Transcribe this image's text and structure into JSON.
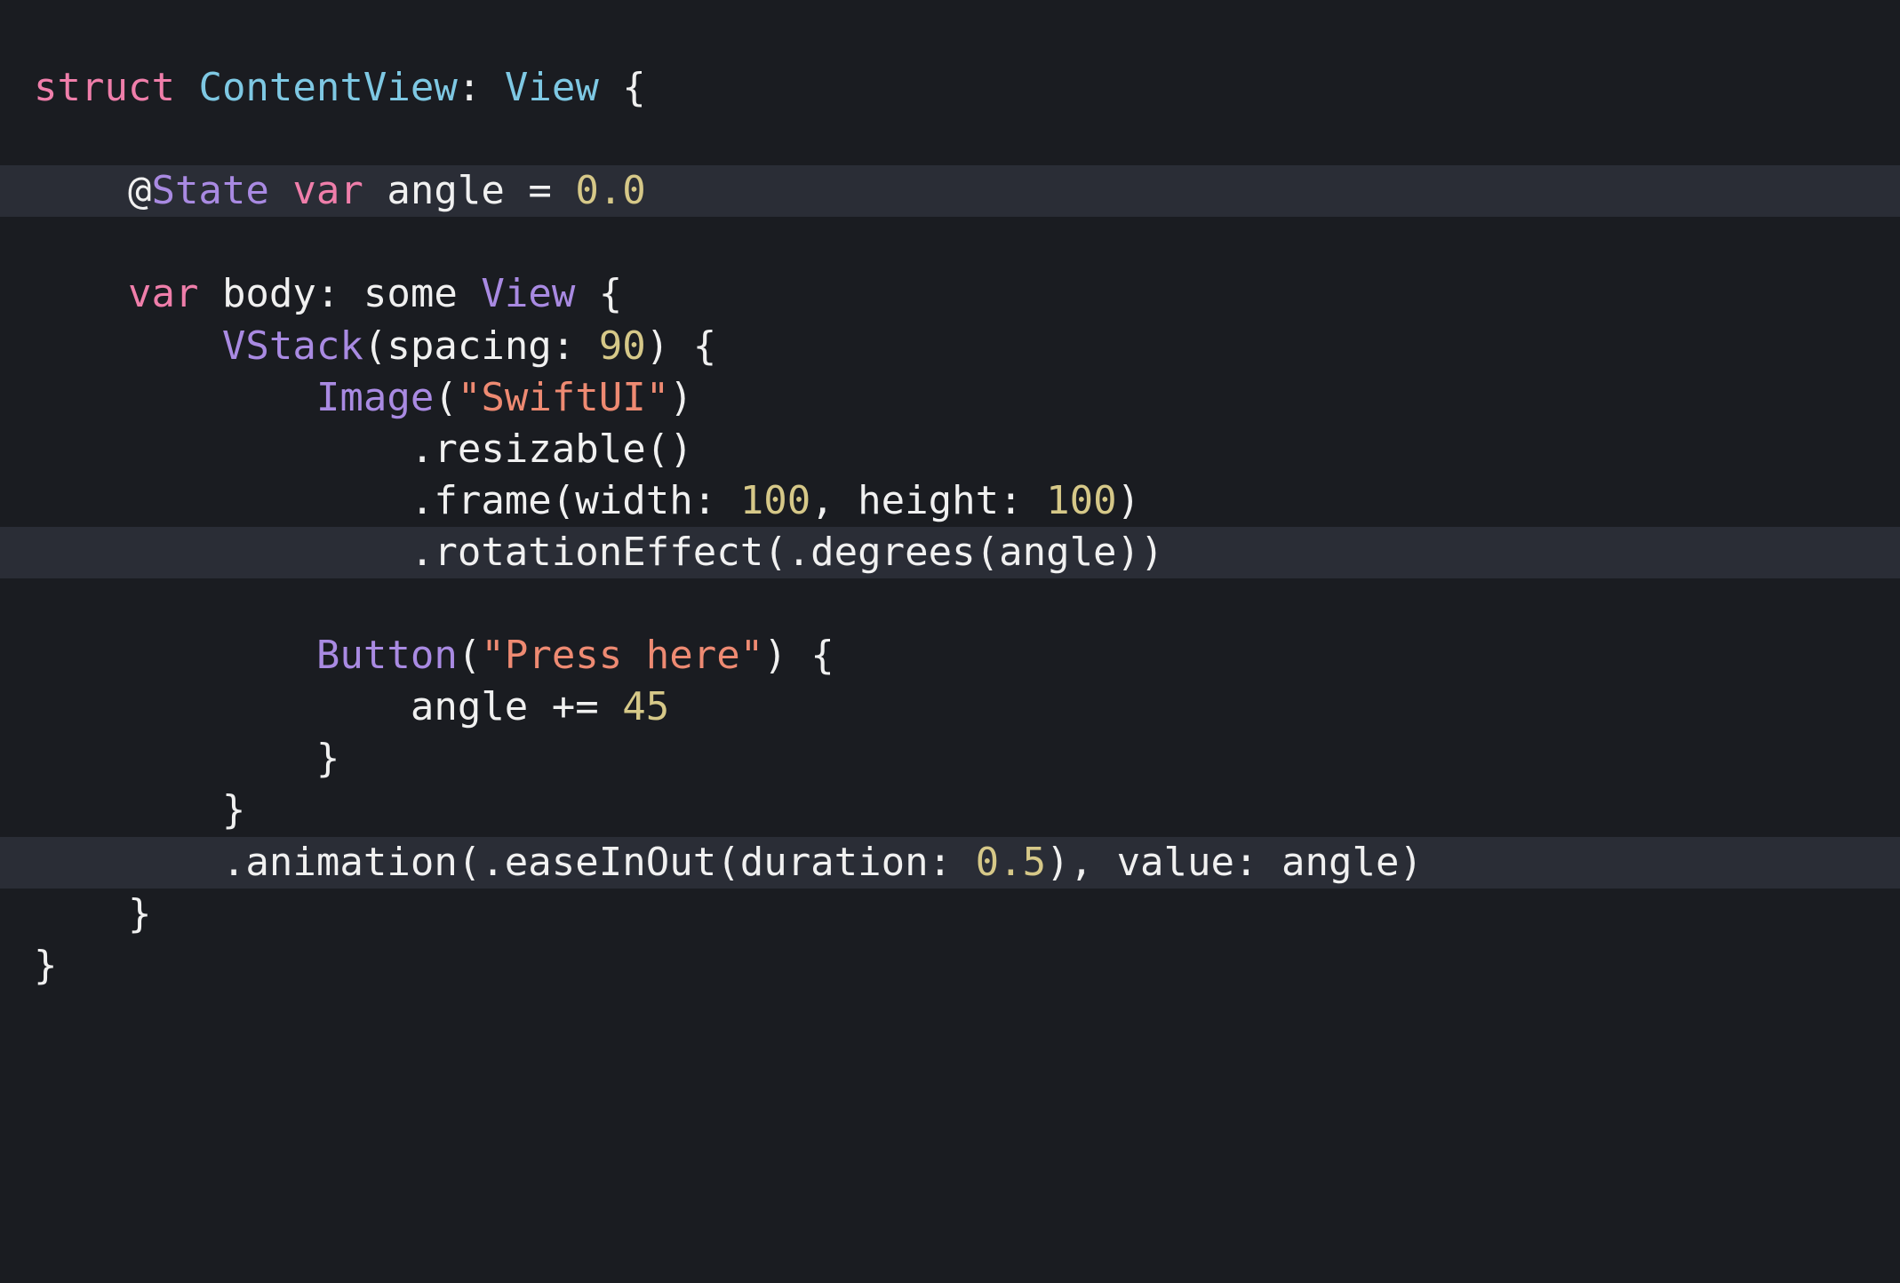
{
  "colors": {
    "background": "#1a1c21",
    "highlight": "#2a2d36",
    "plain": "#f0f0f0",
    "keyword": "#ef7eaa",
    "typeDecl": "#7ec8e3",
    "type": "#a98ae2",
    "number": "#d6c888",
    "string": "#ee8a72"
  },
  "code": {
    "lines": [
      {
        "highlighted": false,
        "tokens": [
          {
            "t": "keyword",
            "v": "struct"
          },
          {
            "t": "plain",
            "v": " "
          },
          {
            "t": "typeDecl",
            "v": "ContentView"
          },
          {
            "t": "plain",
            "v": ": "
          },
          {
            "t": "typeDecl",
            "v": "View"
          },
          {
            "t": "plain",
            "v": " {"
          }
        ]
      },
      {
        "highlighted": false,
        "tokens": []
      },
      {
        "highlighted": true,
        "tokens": [
          {
            "t": "plain",
            "v": "    @"
          },
          {
            "t": "type",
            "v": "State"
          },
          {
            "t": "plain",
            "v": " "
          },
          {
            "t": "keyword",
            "v": "var"
          },
          {
            "t": "plain",
            "v": " angle = "
          },
          {
            "t": "number",
            "v": "0.0"
          }
        ]
      },
      {
        "highlighted": false,
        "tokens": []
      },
      {
        "highlighted": false,
        "tokens": [
          {
            "t": "plain",
            "v": "    "
          },
          {
            "t": "keyword",
            "v": "var"
          },
          {
            "t": "plain",
            "v": " body: some "
          },
          {
            "t": "type",
            "v": "View"
          },
          {
            "t": "plain",
            "v": " {"
          }
        ]
      },
      {
        "highlighted": false,
        "tokens": [
          {
            "t": "plain",
            "v": "        "
          },
          {
            "t": "type",
            "v": "VStack"
          },
          {
            "t": "plain",
            "v": "(spacing: "
          },
          {
            "t": "number",
            "v": "90"
          },
          {
            "t": "plain",
            "v": ") {"
          }
        ]
      },
      {
        "highlighted": false,
        "tokens": [
          {
            "t": "plain",
            "v": "            "
          },
          {
            "t": "type",
            "v": "Image"
          },
          {
            "t": "plain",
            "v": "("
          },
          {
            "t": "string",
            "v": "\"SwiftUI\""
          },
          {
            "t": "plain",
            "v": ")"
          }
        ]
      },
      {
        "highlighted": false,
        "tokens": [
          {
            "t": "plain",
            "v": "                .resizable()"
          }
        ]
      },
      {
        "highlighted": false,
        "tokens": [
          {
            "t": "plain",
            "v": "                .frame(width: "
          },
          {
            "t": "number",
            "v": "100"
          },
          {
            "t": "plain",
            "v": ", height: "
          },
          {
            "t": "number",
            "v": "100"
          },
          {
            "t": "plain",
            "v": ")"
          }
        ]
      },
      {
        "highlighted": true,
        "tokens": [
          {
            "t": "plain",
            "v": "                .rotationEffect(.degrees(angle))"
          }
        ]
      },
      {
        "highlighted": false,
        "tokens": []
      },
      {
        "highlighted": false,
        "tokens": [
          {
            "t": "plain",
            "v": "            "
          },
          {
            "t": "type",
            "v": "Button"
          },
          {
            "t": "plain",
            "v": "("
          },
          {
            "t": "string",
            "v": "\"Press here\""
          },
          {
            "t": "plain",
            "v": ") {"
          }
        ]
      },
      {
        "highlighted": false,
        "tokens": [
          {
            "t": "plain",
            "v": "                angle += "
          },
          {
            "t": "number",
            "v": "45"
          }
        ]
      },
      {
        "highlighted": false,
        "tokens": [
          {
            "t": "plain",
            "v": "            }"
          }
        ]
      },
      {
        "highlighted": false,
        "tokens": [
          {
            "t": "plain",
            "v": "        }"
          }
        ]
      },
      {
        "highlighted": true,
        "tokens": [
          {
            "t": "plain",
            "v": "        .animation(.easeInOut(duration: "
          },
          {
            "t": "number",
            "v": "0.5"
          },
          {
            "t": "plain",
            "v": "), value: angle)"
          }
        ]
      },
      {
        "highlighted": false,
        "tokens": [
          {
            "t": "plain",
            "v": "    }"
          }
        ]
      },
      {
        "highlighted": false,
        "tokens": [
          {
            "t": "plain",
            "v": "}"
          }
        ]
      }
    ]
  }
}
